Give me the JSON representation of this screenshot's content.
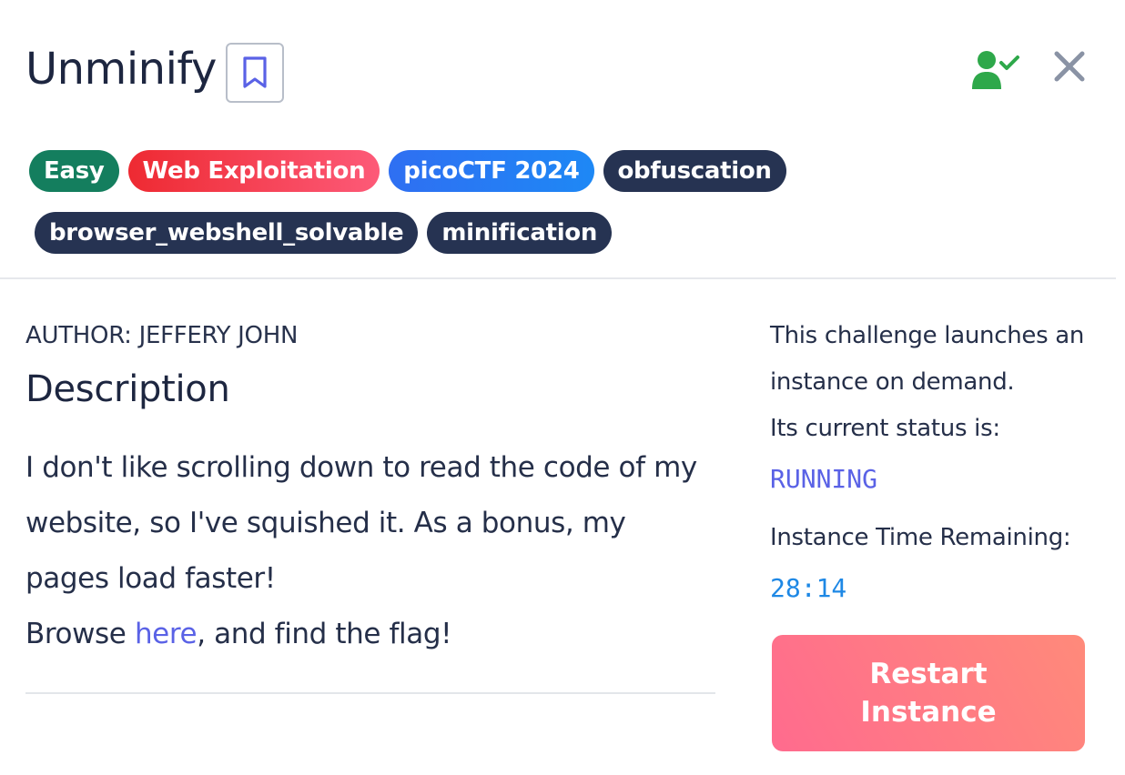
{
  "header": {
    "title": "Unminify"
  },
  "tags": {
    "row1": [
      "Easy",
      "Web Exploitation",
      "picoCTF 2024",
      "obfuscation"
    ],
    "row2": [
      "browser_webshell_solvable",
      "minification"
    ]
  },
  "main": {
    "author": "AUTHOR: JEFFERY JOHN",
    "description_heading": "Description",
    "description_text": "I don't like scrolling down to read the code of my website, so I've squished it. As a bonus, my pages load faster!",
    "browse_prefix": "Browse ",
    "browse_link": "here",
    "browse_suffix": ", and find the flag!"
  },
  "instance": {
    "intro": "This challenge launches an instance on demand.",
    "status_label": "Its current status is:",
    "status_value": "RUNNING",
    "time_label": "Instance Time Remaining:",
    "time_value": "28:14",
    "restart_label": "Restart Instance"
  },
  "colors": {
    "easy": "#147e5e",
    "web": "#ee2a32",
    "pico": "#2f6ff2",
    "dark_tag": "#263352",
    "status": "#5a62e6",
    "solved_icon": "#2ea84a",
    "restart_button": "#ff7a85"
  },
  "icons": {
    "bookmark": "bookmark-icon",
    "solved": "user-check-icon",
    "close": "close-icon"
  }
}
